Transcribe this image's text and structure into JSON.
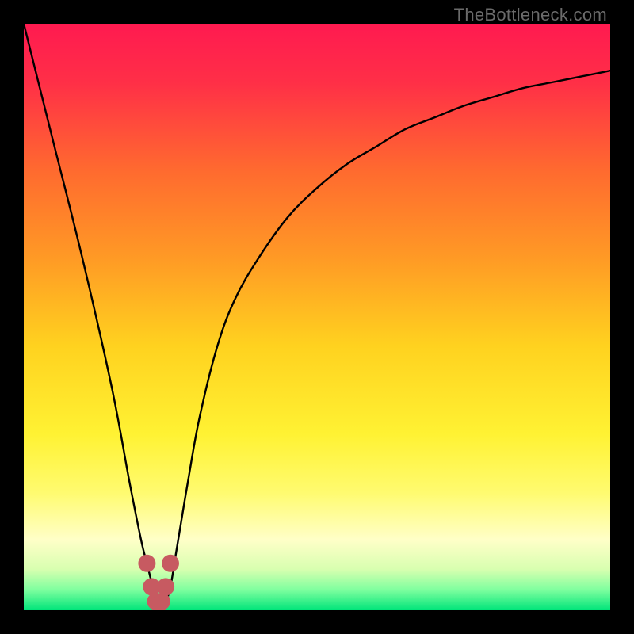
{
  "watermark": {
    "text": "TheBottleneck.com"
  },
  "colors": {
    "frame": "#000000",
    "curve_stroke": "#000000",
    "marker_fill": "#c75a61",
    "marker_stroke": "#b24b52",
    "gradient_stops": [
      {
        "offset": 0.0,
        "color": "#ff1a50"
      },
      {
        "offset": 0.1,
        "color": "#ff2f47"
      },
      {
        "offset": 0.25,
        "color": "#ff6a2f"
      },
      {
        "offset": 0.4,
        "color": "#ff9a25"
      },
      {
        "offset": 0.55,
        "color": "#ffd21f"
      },
      {
        "offset": 0.7,
        "color": "#fff233"
      },
      {
        "offset": 0.8,
        "color": "#fffb70"
      },
      {
        "offset": 0.88,
        "color": "#ffffc8"
      },
      {
        "offset": 0.93,
        "color": "#d8ffb0"
      },
      {
        "offset": 0.965,
        "color": "#7fff9f"
      },
      {
        "offset": 1.0,
        "color": "#00e57a"
      }
    ]
  },
  "chart_data": {
    "type": "line",
    "title": "",
    "xlabel": "",
    "ylabel": "",
    "xlim": [
      0,
      100
    ],
    "ylim": [
      0,
      100
    ],
    "series": [
      {
        "name": "bottleneck-curve",
        "x": [
          0,
          5,
          10,
          15,
          18,
          20,
          21,
          22,
          23,
          24,
          25,
          26,
          28,
          30,
          33,
          36,
          40,
          45,
          50,
          55,
          60,
          65,
          70,
          75,
          80,
          85,
          90,
          95,
          100
        ],
        "values": [
          100,
          80,
          60,
          38,
          22,
          12,
          8,
          4,
          1,
          1,
          4,
          10,
          22,
          33,
          45,
          53,
          60,
          67,
          72,
          76,
          79,
          82,
          84,
          86,
          87.5,
          89,
          90,
          91,
          92
        ]
      }
    ],
    "markers": {
      "name": "highlight-dip",
      "x": [
        21,
        21.8,
        22.5,
        23,
        23.5,
        24.2,
        25
      ],
      "values": [
        8,
        4,
        1.5,
        1,
        1.5,
        4,
        8
      ]
    }
  }
}
